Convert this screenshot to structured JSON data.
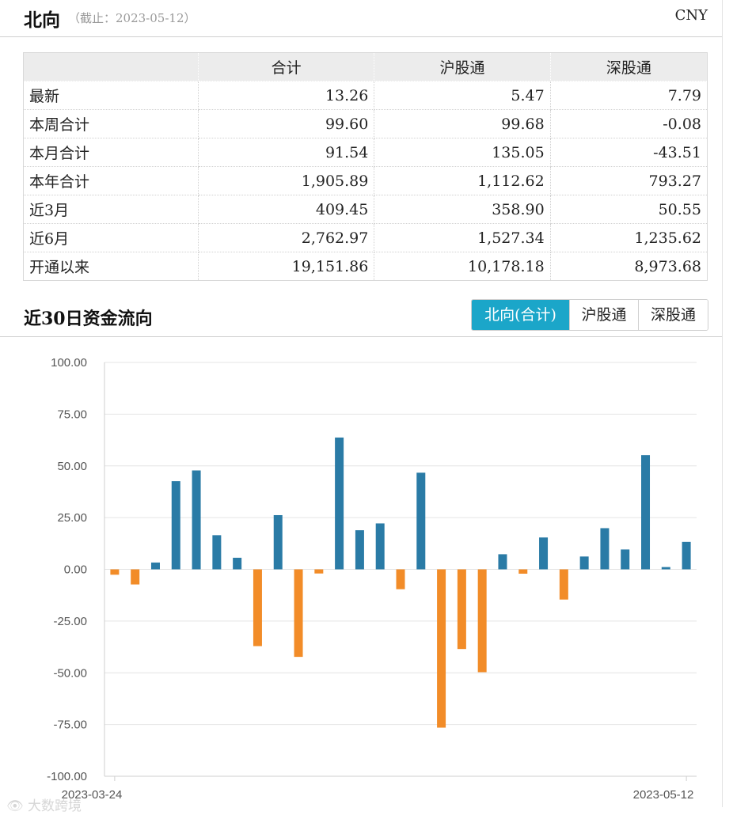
{
  "header": {
    "title": "北向",
    "as_of": "（截止：2023-05-12）",
    "currency": "CNY"
  },
  "summary": {
    "columns": [
      "",
      "合计",
      "沪股通",
      "深股通"
    ],
    "rows": [
      [
        "最新",
        "13.26",
        "5.47",
        "7.79"
      ],
      [
        "本周合计",
        "99.60",
        "99.68",
        "-0.08"
      ],
      [
        "本月合计",
        "91.54",
        "135.05",
        "-43.51"
      ],
      [
        "本年合计",
        "1,905.89",
        "1,112.62",
        "793.27"
      ],
      [
        "近3月",
        "409.45",
        "358.90",
        "50.55"
      ],
      [
        "近6月",
        "2,762.97",
        "1,527.34",
        "1,235.62"
      ],
      [
        "开通以来",
        "19,151.86",
        "10,178.18",
        "8,973.68"
      ]
    ]
  },
  "section": {
    "title": "近30日资金流向",
    "tabs": [
      "北向(合计)",
      "沪股通",
      "深股通"
    ]
  },
  "watermark": "大数跨境",
  "colors": {
    "positive": "#2a7ba6",
    "negative": "#f28c28",
    "active_tab": "#1ba6c9"
  },
  "chart_data": {
    "type": "bar",
    "x_start_label": "2023-03-24",
    "x_end_label": "2023-05-12",
    "yticks": [
      "100.00",
      "75.00",
      "50.00",
      "25.00",
      "0.00",
      "-25.00",
      "-50.00",
      "-75.00",
      "-100.00"
    ],
    "ylim": [
      -100,
      100
    ],
    "values": [
      -2.6,
      -7.3,
      3.3,
      42.6,
      47.8,
      16.5,
      5.6,
      -37.1,
      26.2,
      -42.3,
      -2.0,
      63.7,
      18.9,
      22.2,
      -9.6,
      46.7,
      -76.5,
      -38.5,
      -49.7,
      7.3,
      -2.1,
      15.4,
      -14.6,
      6.2,
      19.9,
      9.6,
      55.2,
      1.1,
      13.26
    ]
  },
  "watermark_icon": "eye-logo-icon"
}
